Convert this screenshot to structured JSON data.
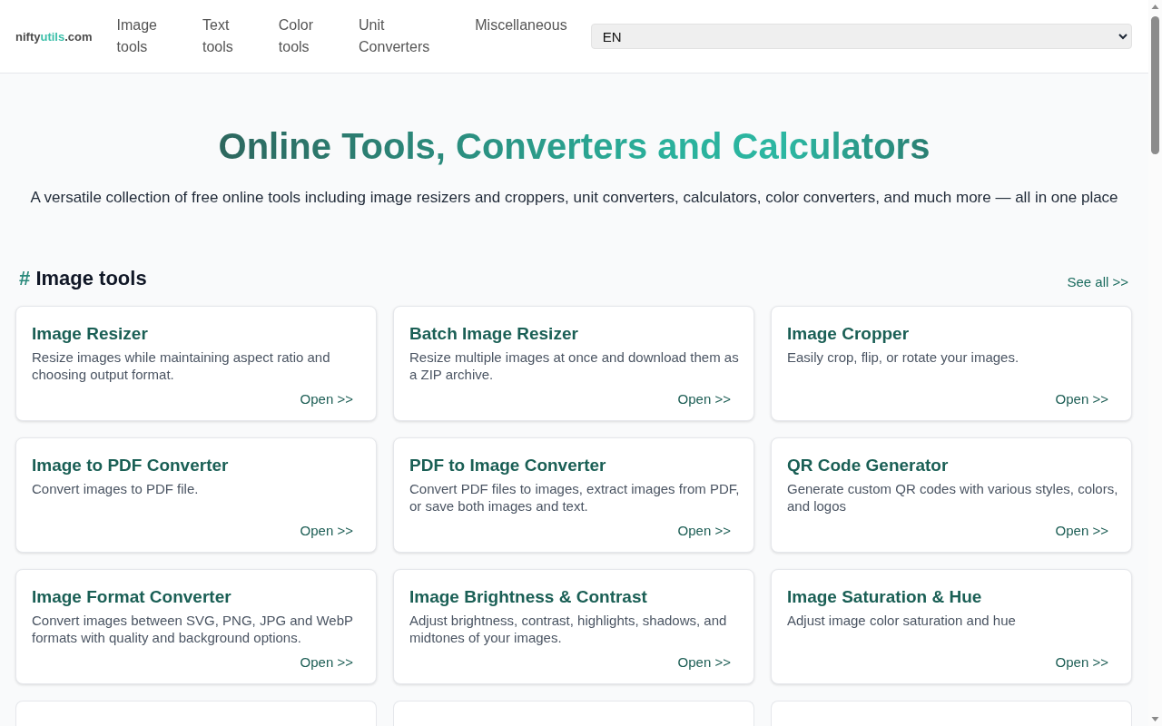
{
  "header": {
    "logo": {
      "prefix": "nifty",
      "accent": "utils",
      "suffix": ".com"
    },
    "nav": [
      "Image tools",
      "Text tools",
      "Color tools",
      "Unit Converters",
      "Miscellaneous"
    ],
    "language_select": {
      "value": "EN"
    }
  },
  "hero": {
    "title": "Online Tools, Converters and Calculators",
    "subtitle": "A versatile collection of free online tools including image resizers and croppers, unit converters, calculators, color converters, and much more — all in one place"
  },
  "sections": [
    {
      "hash": "#",
      "title": "Image tools",
      "see_all": "See all >>",
      "cards": [
        {
          "kind": "tool",
          "title": "Image Resizer",
          "description": "Resize images while maintaining aspect ratio and choosing output format.",
          "link": "Open >>"
        },
        {
          "kind": "tool",
          "title": "Batch Image Resizer",
          "description": "Resize multiple images at once and download them as a ZIP archive.",
          "link": "Open >>"
        },
        {
          "kind": "tool",
          "title": "Image Cropper",
          "description": "Easily crop, flip, or rotate your images.",
          "link": "Open >>"
        },
        {
          "kind": "tool",
          "title": "Image to PDF Converter",
          "description": "Convert images to PDF file.",
          "link": "Open >>"
        },
        {
          "kind": "tool",
          "title": "PDF to Image Converter",
          "description": "Convert PDF files to images, extract images from PDF, or save both images and text.",
          "link": "Open >>"
        },
        {
          "kind": "tool",
          "title": "QR Code Generator",
          "description": "Generate custom QR codes with various styles, colors, and logos",
          "link": "Open >>"
        },
        {
          "kind": "tool",
          "title": "Image Format Converter",
          "description": "Convert images between SVG, PNG, JPG and WebP formats with quality and background options.",
          "link": "Open >>"
        },
        {
          "kind": "tool",
          "title": "Image Brightness & Contrast",
          "description": "Adjust brightness, contrast, highlights, shadows, and midtones of your images.",
          "link": "Open >>"
        },
        {
          "kind": "tool",
          "title": "Image Saturation & Hue",
          "description": "Adjust image color saturation and hue",
          "link": "Open >>"
        },
        {
          "kind": "cut"
        },
        {
          "kind": "cut"
        },
        {
          "kind": "cut"
        }
      ]
    }
  ]
}
